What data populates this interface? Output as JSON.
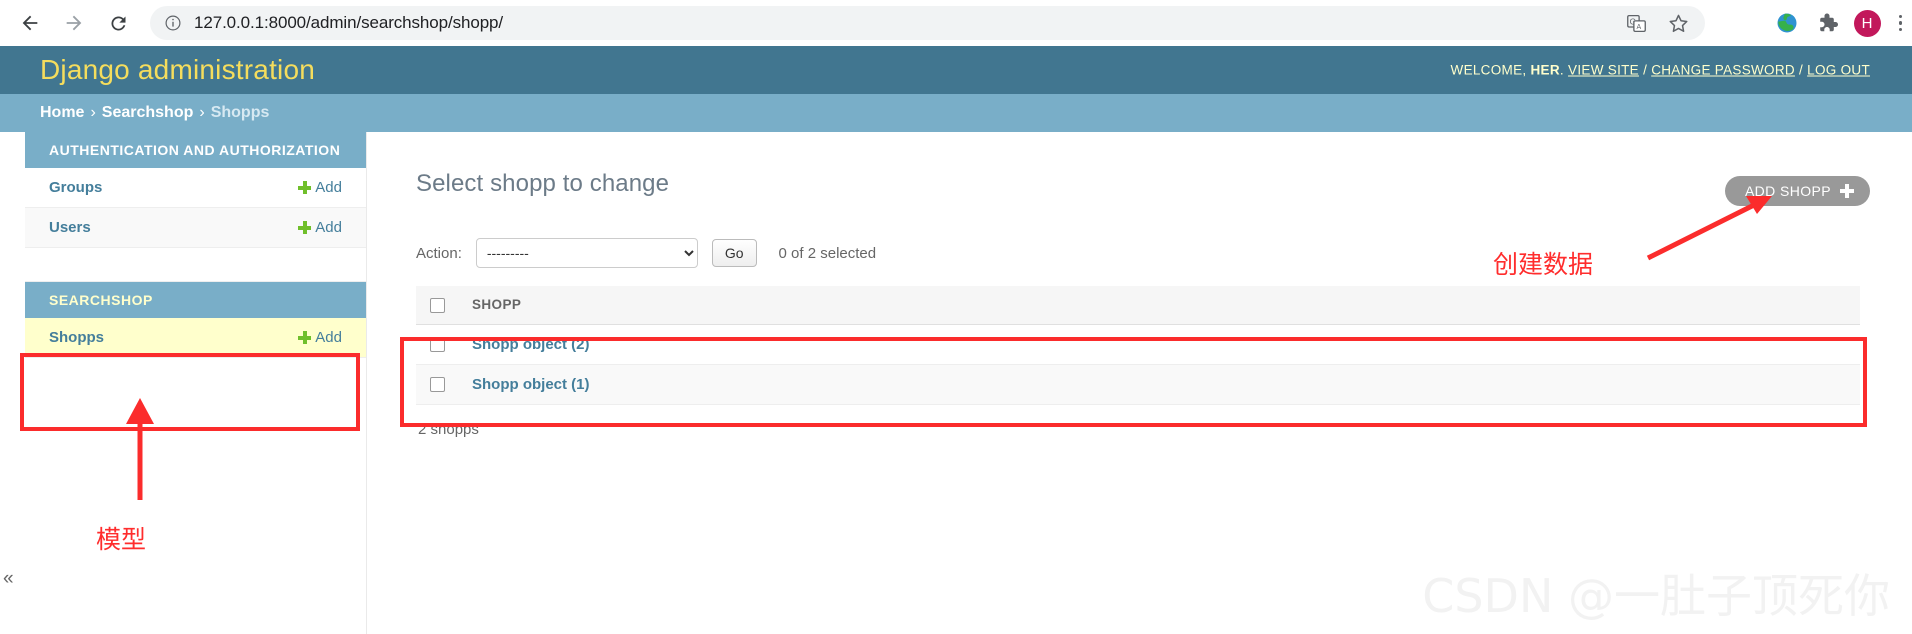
{
  "browser": {
    "back_label": "Back",
    "forward_label": "Forward",
    "reload_label": "Reload",
    "url": "127.0.0.1:8000/admin/searchshop/shopp/",
    "info_icon": "info-circle-icon",
    "bookmark_icon": "star-icon",
    "translate_icon": "translate-icon",
    "extension_icon": "puzzle-icon",
    "globe_icon": "globe-icon",
    "avatar_initial": "H",
    "menu_icon": "kebab-menu-icon"
  },
  "header": {
    "branding": "Django administration",
    "welcome_prefix": "WELCOME,",
    "username": "HER",
    "welcome_suffix": ".",
    "view_site": "VIEW SITE",
    "change_password": "CHANGE PASSWORD",
    "log_out": "LOG OUT",
    "separator": "/"
  },
  "breadcrumbs": {
    "home": "Home",
    "app": "Searchshop",
    "current": "Shopps",
    "separator": "›"
  },
  "sidebar": {
    "collapse_glyph": "«",
    "groups": [
      {
        "caption": "AUTHENTICATION AND AUTHORIZATION",
        "rows": [
          {
            "label": "Groups",
            "add_label": "Add"
          },
          {
            "label": "Users",
            "add_label": "Add"
          }
        ]
      },
      {
        "caption": "SEARCHSHOP",
        "rows": [
          {
            "label": "Shopps",
            "add_label": "Add"
          }
        ]
      }
    ]
  },
  "main": {
    "title": "Select shopp to change",
    "add_button": "ADD SHOPP",
    "action_label": "Action:",
    "action_selected": "---------",
    "action_options": [
      "---------"
    ],
    "go_button": "Go",
    "selection_counter": "0 of 2 selected",
    "columns": [
      "SHOPP"
    ],
    "rows": [
      {
        "name": "Shopp object (2)"
      },
      {
        "name": "Shopp object (1)"
      }
    ],
    "paginator": "2 shopps"
  },
  "annotations": {
    "create_data": "创建数据",
    "model": "模型",
    "box_color": "#fb2c2c",
    "arrow_color": "#fb2c2c"
  },
  "watermark": {
    "text": "CSDN @一肚子顶死你"
  },
  "colors": {
    "django_header": "#417690",
    "breadcrumb": "#79aec8",
    "brand_yellow": "#f5dd5d",
    "link_blue": "#447e9b",
    "add_green": "#70bf2b",
    "highlight_yellow": "#ffffcc"
  }
}
